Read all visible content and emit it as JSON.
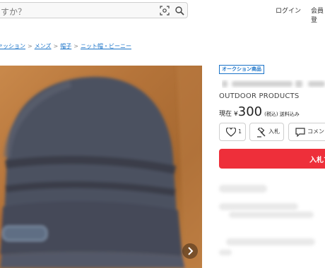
{
  "header": {
    "search_placeholder": "すか？",
    "login_label": "ログイン",
    "register_label": "会員登"
  },
  "breadcrumb": [
    "ァッション",
    "メンズ",
    "帽子",
    "ニット帽・ビーニー"
  ],
  "product": {
    "badge": "オークション商品",
    "brand": "OUTDOOR PRODUCTS",
    "price_label": "現在",
    "currency": "¥",
    "price": "300",
    "tax_note": "(税込) 送料込み"
  },
  "actions": {
    "like_count": "1",
    "bid_short_label": "入札",
    "comment_label": "コメント",
    "bid_button_label": "入札す"
  },
  "colors": {
    "accent_red": "#ee2f3a",
    "link_blue": "#1a73c8"
  }
}
